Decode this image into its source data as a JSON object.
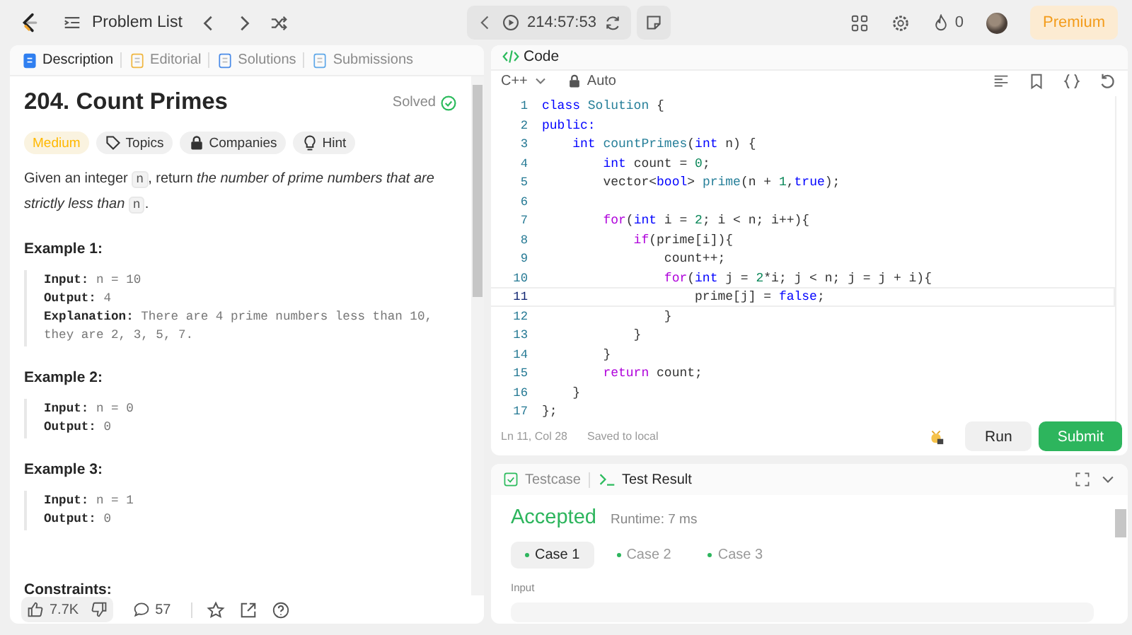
{
  "top_bar": {
    "problem_list": "Problem List",
    "timer": "214:57:53",
    "streak": "0",
    "premium": "Premium"
  },
  "description_panel": {
    "tabs": [
      {
        "label": "Description",
        "selected": true
      },
      {
        "label": "Editorial",
        "selected": false
      },
      {
        "label": "Solutions",
        "selected": false
      },
      {
        "label": "Submissions",
        "selected": false
      }
    ],
    "title": "204. Count Primes",
    "status": "Solved",
    "tags": [
      {
        "label": "Medium",
        "kind": "difficulty"
      },
      {
        "label": "Topics",
        "kind": "topics"
      },
      {
        "label": "Companies",
        "kind": "companies"
      },
      {
        "label": "Hint",
        "kind": "hint"
      }
    ],
    "statement": [
      {
        "text": "Given an integer ",
        "kind": "plain"
      },
      {
        "text": "n",
        "kind": "code"
      },
      {
        "text": ", return ",
        "kind": "plain"
      },
      {
        "text": "the number of prime numbers that are strictly less than ",
        "kind": "italic"
      },
      {
        "text": "n",
        "kind": "code"
      },
      {
        "text": ".",
        "kind": "plain"
      }
    ],
    "examples": [
      {
        "heading": "Example 1:",
        "lines": [
          {
            "label": "Input:",
            "value": "n = 10"
          },
          {
            "label": "Output:",
            "value": "4"
          },
          {
            "label": "Explanation:",
            "value": "There are 4 prime numbers less than 10, they are 2, 3, 5, 7."
          }
        ]
      },
      {
        "heading": "Example 2:",
        "lines": [
          {
            "label": "Input:",
            "value": "n = 0"
          },
          {
            "label": "Output:",
            "value": "0"
          }
        ]
      },
      {
        "heading": "Example 3:",
        "lines": [
          {
            "label": "Input:",
            "value": "n = 1"
          },
          {
            "label": "Output:",
            "value": "0"
          }
        ]
      }
    ],
    "constraints_heading": "Constraints:",
    "footer": {
      "likes": "7.7K",
      "comments": "57"
    }
  },
  "code_panel": {
    "title": "Code",
    "language": "C++",
    "mode": "Auto",
    "lines": [
      {
        "number": "1",
        "current": false,
        "tokens": [
          {
            "text": "class ",
            "kind": "keyword"
          },
          {
            "text": "Solution",
            "kind": "type"
          },
          {
            "text": " {",
            "kind": "plain"
          }
        ]
      },
      {
        "number": "2",
        "current": false,
        "tokens": [
          {
            "text": "public:",
            "kind": "keyword"
          }
        ]
      },
      {
        "number": "3",
        "current": false,
        "tokens": [
          {
            "text": "    int ",
            "kind": "keyword"
          },
          {
            "text": "countPrimes",
            "kind": "type"
          },
          {
            "text": "(",
            "kind": "plain"
          },
          {
            "text": "int",
            "kind": "keyword"
          },
          {
            "text": " n) {",
            "kind": "plain"
          }
        ]
      },
      {
        "number": "4",
        "current": false,
        "tokens": [
          {
            "text": "        int ",
            "kind": "keyword"
          },
          {
            "text": "count = ",
            "kind": "plain"
          },
          {
            "text": "0",
            "kind": "number"
          },
          {
            "text": ";",
            "kind": "plain"
          }
        ]
      },
      {
        "number": "5",
        "current": false,
        "tokens": [
          {
            "text": "        vector<",
            "kind": "plain"
          },
          {
            "text": "bool",
            "kind": "keyword"
          },
          {
            "text": "> ",
            "kind": "plain"
          },
          {
            "text": "prime",
            "kind": "type"
          },
          {
            "text": "(n + ",
            "kind": "plain"
          },
          {
            "text": "1",
            "kind": "number"
          },
          {
            "text": ",",
            "kind": "plain"
          },
          {
            "text": "true",
            "kind": "keyword"
          },
          {
            "text": ");",
            "kind": "plain"
          }
        ]
      },
      {
        "number": "6",
        "current": false
      },
      {
        "number": "7",
        "current": false,
        "tokens": [
          {
            "text": "        for",
            "kind": "control"
          },
          {
            "text": "(",
            "kind": "plain"
          },
          {
            "text": "int",
            "kind": "keyword"
          },
          {
            "text": " i = ",
            "kind": "plain"
          },
          {
            "text": "2",
            "kind": "number"
          },
          {
            "text": "; i < n; i++){",
            "kind": "plain"
          }
        ]
      },
      {
        "number": "8",
        "current": false,
        "tokens": [
          {
            "text": "            if",
            "kind": "control"
          },
          {
            "text": "(prime[i]){",
            "kind": "plain"
          }
        ]
      },
      {
        "number": "9",
        "current": false,
        "tokens": [
          {
            "text": "                count++;",
            "kind": "plain"
          }
        ]
      },
      {
        "number": "10",
        "current": false,
        "tokens": [
          {
            "text": "                for",
            "kind": "control"
          },
          {
            "text": "(",
            "kind": "plain"
          },
          {
            "text": "int",
            "kind": "keyword"
          },
          {
            "text": " j = ",
            "kind": "plain"
          },
          {
            "text": "2",
            "kind": "number"
          },
          {
            "text": "*i; j < n; j = j + i){",
            "kind": "plain"
          }
        ]
      },
      {
        "number": "11",
        "current": true,
        "tokens": [
          {
            "text": "                    prime[j] = ",
            "kind": "plain"
          },
          {
            "text": "false",
            "kind": "keyword"
          },
          {
            "text": ";",
            "kind": "plain"
          }
        ]
      },
      {
        "number": "12",
        "current": false,
        "tokens": [
          {
            "text": "                }",
            "kind": "plain"
          }
        ]
      },
      {
        "number": "13",
        "current": false,
        "tokens": [
          {
            "text": "            }",
            "kind": "plain"
          }
        ]
      },
      {
        "number": "14",
        "current": false,
        "tokens": [
          {
            "text": "        }",
            "kind": "plain"
          }
        ]
      },
      {
        "number": "15",
        "current": false,
        "tokens": [
          {
            "text": "        return",
            "kind": "control"
          },
          {
            "text": " count;",
            "kind": "plain"
          }
        ]
      },
      {
        "number": "16",
        "current": false,
        "tokens": [
          {
            "text": "    }",
            "kind": "plain"
          }
        ]
      },
      {
        "number": "17",
        "current": false,
        "tokens": [
          {
            "text": "};",
            "kind": "plain"
          }
        ]
      }
    ],
    "cursor": "Ln 11, Col 28",
    "save_status": "Saved to local",
    "run": "Run",
    "submit": "Submit"
  },
  "test_panel": {
    "tabs": [
      {
        "label": "Testcase",
        "selected": false
      },
      {
        "label": "Test Result",
        "selected": true
      }
    ],
    "verdict": "Accepted",
    "runtime": "Runtime: 7 ms",
    "cases": [
      {
        "label": "Case 1",
        "selected": true
      },
      {
        "label": "Case 2",
        "selected": false
      },
      {
        "label": "Case 3",
        "selected": false
      }
    ],
    "input_label": "Input"
  }
}
